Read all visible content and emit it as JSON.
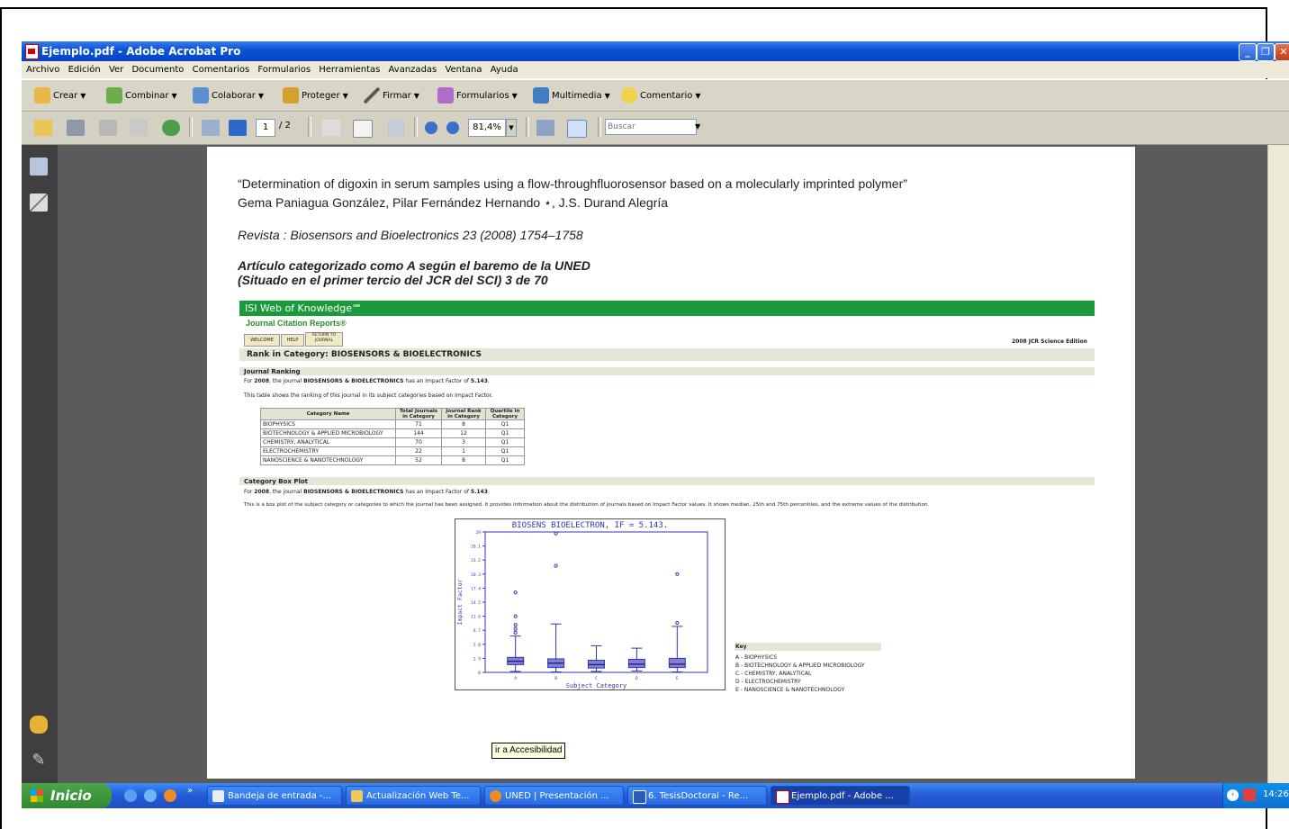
{
  "window": {
    "title": "Ejemplo.pdf - Adobe Acrobat Pro"
  },
  "menu": [
    "Archivo",
    "Edición",
    "Ver",
    "Documento",
    "Comentarios",
    "Formularios",
    "Herramientas",
    "Avanzadas",
    "Ventana",
    "Ayuda"
  ],
  "task_toolbar": {
    "crear": "Crear",
    "combinar": "Combinar",
    "colaborar": "Colaborar",
    "proteger": "Proteger",
    "firmar": "Firmar",
    "formularios": "Formularios",
    "multimedia": "Multimedia",
    "comentario": "Comentario"
  },
  "nav_toolbar": {
    "page_current": "1",
    "page_total": "/ 2",
    "zoom": "81,4%",
    "search_placeholder": "Buscar"
  },
  "document": {
    "title_line": "“Determination of digoxin in serum samples using a flow-throughfluorosensor based on a molecularly imprinted polymer”",
    "authors": "Gema Paniagua González, Pilar Fernández Hernando ⋆, J.S. Durand Alegría",
    "journal": "Revista : Biosensors and Bioelectronics 23 (2008) 1754–1758",
    "category_line1": "Artículo categorizado como A según el baremo de la UNED",
    "category_line2": "(Situado en el primer tercio del JCR del SCI) 3 de 70",
    "jcr": {
      "band": "ISI Web of Knowledge℠",
      "subtitle": "Journal Citation Reports®",
      "buttons": [
        "WELCOME",
        "HELP",
        "RETURN TO JOURNAL"
      ],
      "edition": "2008 JCR Science Edition",
      "rank_title": "Rank in Category: BIOSENSORS & BIOELECTRONICS",
      "ranking_heading": "Journal Ranking",
      "ranking_text_pre": "For ",
      "ranking_year": "2008",
      "ranking_text_mid": ", the journal ",
      "ranking_journal": "BIOSENSORS & BIOELECTRONICS",
      "ranking_text_post": " has an Impact Factor of ",
      "ranking_if": "5.143",
      "ranking_text_end": ".",
      "table_intro": "This table shows the ranking of this journal in its subject categories based on Impact Factor.",
      "table_headers": [
        "Category Name",
        "Total Journals in Category",
        "Journal Rank in Category",
        "Quartile in Category"
      ],
      "table_rows": [
        [
          "BIOPHYSICS",
          "71",
          "8",
          "Q1"
        ],
        [
          "BIOTECHNOLOGY & APPLIED MICROBIOLOGY",
          "144",
          "12",
          "Q1"
        ],
        [
          "CHEMISTRY, ANALYTICAL",
          "70",
          "3",
          "Q1"
        ],
        [
          "ELECTROCHEMISTRY",
          "22",
          "1",
          "Q1"
        ],
        [
          "NANOSCIENCE & NANOTECHNOLOGY",
          "52",
          "8",
          "Q1"
        ]
      ],
      "boxplot_heading": "Category Box Plot",
      "boxplot_intro": "This is a box plot of the subject category or categories to which the journal has been assigned. It provides information about the distribution of journals based on Impact Factor values. It shows median, 25th and 75th percentiles, and the extreme values of the distribution.",
      "key_title": "Key",
      "key_items": [
        "A -  BIOPHYSICS",
        "B -  BIOTECHNOLOGY & APPLIED MICROBIOLOGY",
        "C -  CHEMISTRY, ANALYTICAL",
        "D -  ELECTROCHEMISTRY",
        "E -  NANOSCIENCE & NANOTECHNOLOGY"
      ]
    }
  },
  "chart_data": {
    "type": "box",
    "title": "BIOSENS BIOELECTRON, IF = 5.143.",
    "xlabel": "Subject Category",
    "ylabel": "Impact Factor",
    "ylim": [
      0,
      29
    ],
    "yticks": [
      "29",
      "26.1",
      "23.2",
      "20.3",
      "17.4",
      "14.5",
      "11.6",
      "8.7",
      "5.8",
      "2.9",
      "0"
    ],
    "categories": [
      "A",
      "B",
      "C",
      "D",
      "E"
    ],
    "boxes": [
      {
        "name": "A",
        "whisker_low": 0.2,
        "q1": 1.6,
        "median": 2.3,
        "q3": 3.1,
        "whisker_high": 7.5,
        "outliers": [
          8.2,
          9.0,
          9.8,
          11.6,
          16.5
        ]
      },
      {
        "name": "B",
        "whisker_low": 0.1,
        "q1": 1.0,
        "median": 1.9,
        "q3": 2.8,
        "whisker_high": 10.0,
        "outliers": [
          22.0,
          28.7
        ]
      },
      {
        "name": "C",
        "whisker_low": 0.2,
        "q1": 0.9,
        "median": 1.6,
        "q3": 2.5,
        "whisker_high": 5.5,
        "outliers": []
      },
      {
        "name": "D",
        "whisker_low": 0.3,
        "q1": 1.0,
        "median": 1.7,
        "q3": 2.7,
        "whisker_high": 5.0,
        "outliers": []
      },
      {
        "name": "E",
        "whisker_low": 0.1,
        "q1": 1.0,
        "median": 1.7,
        "q3": 2.9,
        "whisker_high": 9.5,
        "outliers": [
          10.2,
          20.3
        ]
      }
    ]
  },
  "tooltip": "ir a Accesibilidad",
  "taskbar": {
    "start": "Inicio",
    "buttons": [
      "Bandeja de entrada -...",
      "Actualización Web Te...",
      "UNED | Presentación ...",
      "6. TesisDoctoral - Re...",
      "Ejemplo.pdf - Adobe ..."
    ],
    "clock": "14:26"
  }
}
